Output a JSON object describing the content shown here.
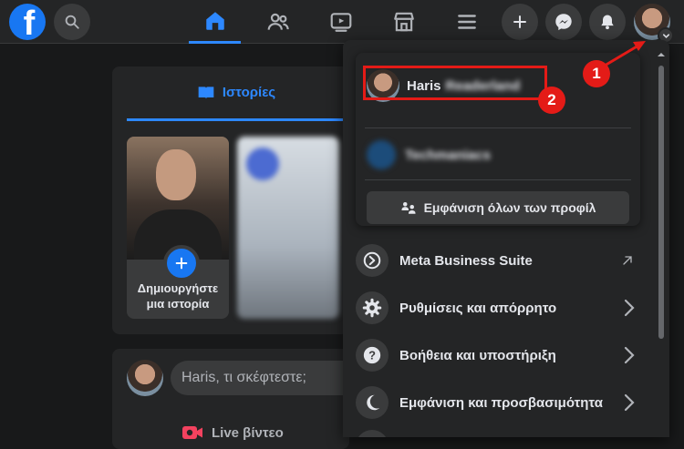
{
  "header": {
    "logo_letter": "f",
    "nav": [
      "home-icon",
      "friends-icon",
      "watch-icon",
      "marketplace-icon",
      "menu-icon"
    ],
    "right": [
      "plus-icon",
      "messenger-icon",
      "bell-icon"
    ]
  },
  "feed": {
    "stories_tab": "Ιστορίες",
    "create_story_label": "Δημιουργήστε μια ιστορία",
    "composer_placeholder": "Haris, τι σκέφτεστε;",
    "live_video": "Live βίντεο"
  },
  "account_menu": {
    "profile_first_name": "Haris",
    "profile_last_name": "Readerland",
    "page_name": "Techmaniacs",
    "see_all_profiles": "Εμφάνιση όλων των προφίλ",
    "items": [
      {
        "label": "Meta Business Suite",
        "icon": "meta-business-icon",
        "trail": "external-arrow-icon"
      },
      {
        "label": "Ρυθμίσεις και απόρρητο",
        "icon": "gear-icon",
        "trail": "chevron-right-icon"
      },
      {
        "label": "Βοήθεια και υποστήριξη",
        "icon": "help-icon",
        "trail": "chevron-right-icon"
      },
      {
        "label": "Εμφάνιση και προσβασιμότητα",
        "icon": "moon-icon",
        "trail": "chevron-right-icon"
      }
    ]
  },
  "annotations": [
    "1",
    "2"
  ],
  "colors": {
    "accent": "#2d88ff",
    "annotation_red": "#e41b17",
    "surface": "#242526",
    "background": "#18191a"
  }
}
